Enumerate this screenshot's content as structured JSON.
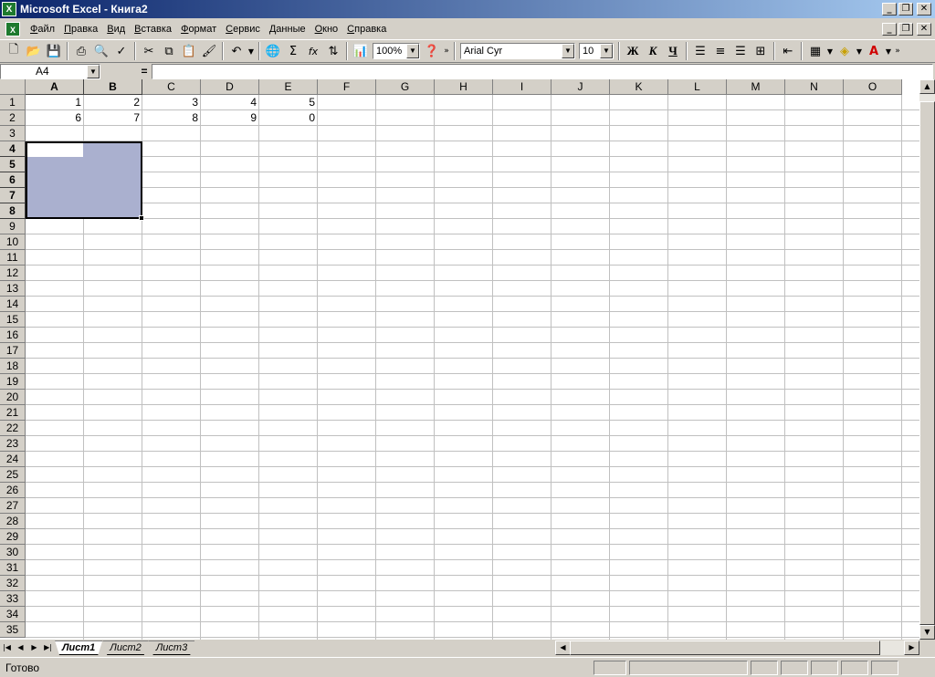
{
  "window": {
    "title": "Microsoft Excel - Книга2",
    "app_icon": "X"
  },
  "menu": {
    "items": [
      {
        "label": "Файл",
        "ul": "Ф",
        "rest": "айл"
      },
      {
        "label": "Правка",
        "ul": "П",
        "rest": "равка"
      },
      {
        "label": "Вид",
        "ul": "В",
        "rest": "ид"
      },
      {
        "label": "Вставка",
        "ul": "В",
        "rest": "ставка"
      },
      {
        "label": "Формат",
        "ul": "Ф",
        "rest": "ормат"
      },
      {
        "label": "Сервис",
        "ul": "С",
        "rest": "ервис"
      },
      {
        "label": "Данные",
        "ul": "Д",
        "rest": "анные"
      },
      {
        "label": "Окно",
        "ul": "О",
        "rest": "кно"
      },
      {
        "label": "Справка",
        "ul": "С",
        "rest": "правка"
      }
    ]
  },
  "toolbar": {
    "zoom": "100%",
    "font_name": "Arial Cyr",
    "font_size": "10",
    "bold_label": "Ж",
    "italic_label": "К",
    "underline_label": "Ч",
    "sum_label": "Σ",
    "fx_label": "fx"
  },
  "formula_bar": {
    "name_box": "A4",
    "equals": "=",
    "formula": ""
  },
  "grid": {
    "columns": [
      "A",
      "B",
      "C",
      "D",
      "E",
      "F",
      "G",
      "H",
      "I",
      "J",
      "K",
      "L",
      "M",
      "N",
      "O"
    ],
    "rows": [
      "1",
      "2",
      "3",
      "4",
      "5",
      "6",
      "7",
      "8",
      "9",
      "10",
      "11",
      "12",
      "13",
      "14",
      "15",
      "16",
      "17",
      "18",
      "19",
      "20",
      "21",
      "22",
      "23",
      "24",
      "25",
      "26",
      "27",
      "28",
      "29",
      "30",
      "31",
      "32",
      "33",
      "34",
      "35"
    ],
    "row1": [
      "1",
      "2",
      "3",
      "4",
      "5"
    ],
    "row2": [
      "6",
      "7",
      "8",
      "9",
      "0"
    ],
    "selection": "A4:B8",
    "selection_color": "#aab0cf"
  },
  "sheets": [
    "Лист1",
    "Лист2",
    "Лист3"
  ],
  "status": {
    "text": "Готово"
  }
}
